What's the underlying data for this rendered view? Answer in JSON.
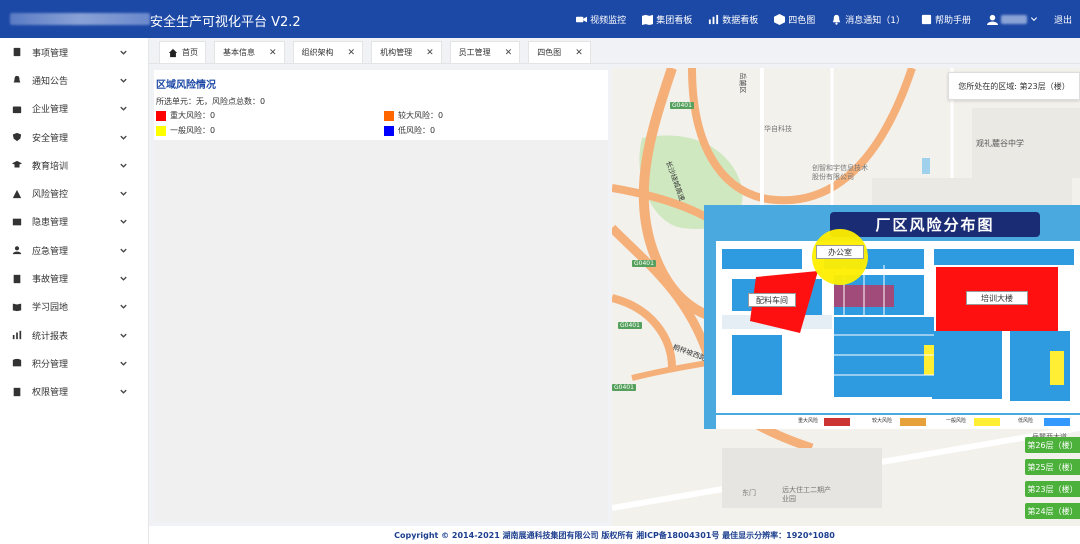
{
  "header": {
    "title": "安全生产可视化平台  V2.2",
    "nav": [
      {
        "label": "视频监控",
        "icon": "video-camera-icon"
      },
      {
        "label": "集团看板",
        "icon": "map-icon"
      },
      {
        "label": "数据看板",
        "icon": "bar-chart-icon"
      },
      {
        "label": "四色图",
        "icon": "cube-icon"
      },
      {
        "label": "消息通知（1）",
        "icon": "bell-icon"
      },
      {
        "label": "帮助手册",
        "icon": "book-icon"
      }
    ],
    "logout_label": "退出"
  },
  "sidebar": {
    "items": [
      {
        "label": "事项管理",
        "icon": "document-icon"
      },
      {
        "label": "通知公告",
        "icon": "bell-icon"
      },
      {
        "label": "企业管理",
        "icon": "briefcase-icon"
      },
      {
        "label": "安全管理",
        "icon": "shield-icon"
      },
      {
        "label": "教育培训",
        "icon": "graduation-cap-icon"
      },
      {
        "label": "风险管控",
        "icon": "warning-icon"
      },
      {
        "label": "隐患管理",
        "icon": "hazard-icon"
      },
      {
        "label": "应急管理",
        "icon": "user-alert-icon"
      },
      {
        "label": "事故管理",
        "icon": "accident-icon"
      },
      {
        "label": "学习园地",
        "icon": "book-open-icon"
      },
      {
        "label": "统计报表",
        "icon": "stats-icon"
      },
      {
        "label": "积分管理",
        "icon": "database-icon"
      },
      {
        "label": "权限管理",
        "icon": "lock-document-icon"
      }
    ]
  },
  "tabs": [
    {
      "label": "首页",
      "closable": false
    },
    {
      "label": "基本信息",
      "closable": true
    },
    {
      "label": "组织架构",
      "closable": true
    },
    {
      "label": "机构管理",
      "closable": true
    },
    {
      "label": "员工管理",
      "closable": true
    },
    {
      "label": "四色图",
      "closable": true
    }
  ],
  "panel": {
    "title": "区域风险情况",
    "info": "所选单元：无，风险点总数：0",
    "legend": [
      {
        "label": "重大风险：0",
        "color": "#ff0000"
      },
      {
        "label": "较大风险：0",
        "color": "#ff6600"
      },
      {
        "label": "一般风险：0",
        "color": "#ffff00"
      },
      {
        "label": "低风险：0",
        "color": "#0000ff"
      }
    ]
  },
  "map": {
    "location": "您所处在的区域: 第23层（楼）",
    "labels": {
      "school": "观礼麓谷中学",
      "company1": "华自科技",
      "company2": "创智和宇信息技术股份有限公司",
      "park": "远大住工二期产业园",
      "gate": "东门",
      "road1": "长沙绕城高速",
      "road2": "桐梓坡西路",
      "road3": "岳麓西大道",
      "road4": "岳麓区"
    },
    "road_signs": [
      "G0401",
      "G0401",
      "G0401",
      "G0401"
    ]
  },
  "factory": {
    "title": "厂区风险分布图",
    "labels": {
      "office": "办公室",
      "workshop": "配料车间",
      "training": "培训大楼"
    },
    "legend": [
      "重大风险",
      "较大风险",
      "一般风险",
      "低风险"
    ]
  },
  "floors": [
    "第26层（楼）",
    "第25层（楼）",
    "第23层（楼）",
    "第24层（楼）"
  ],
  "footer": "Copyright © 2014-2021 湖南展通科技集团有限公司 版权所有 湘ICP备18004301号 最佳显示分辨率：1920*1080"
}
